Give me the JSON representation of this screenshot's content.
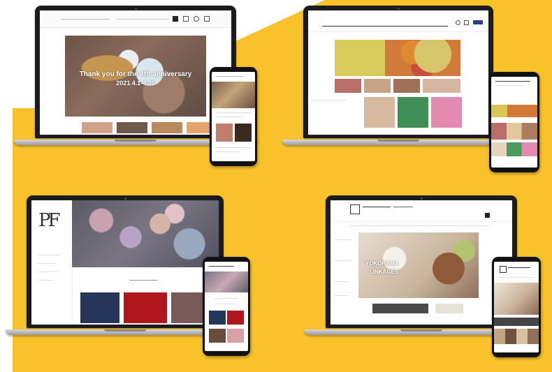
{
  "colors": {
    "background_accent": "#f9c22b",
    "page_bg": "#ffffff"
  },
  "mockup_1": {
    "hero_line1": "Thank you for the 4th anniversary",
    "hero_line2": "2021.4.1-4.30"
  },
  "mockup_3": {
    "logo_mark": "PF"
  },
  "mockup_4": {
    "hero_line1": "YOKOHAMA",
    "hero_line2": "LINKAGES"
  }
}
